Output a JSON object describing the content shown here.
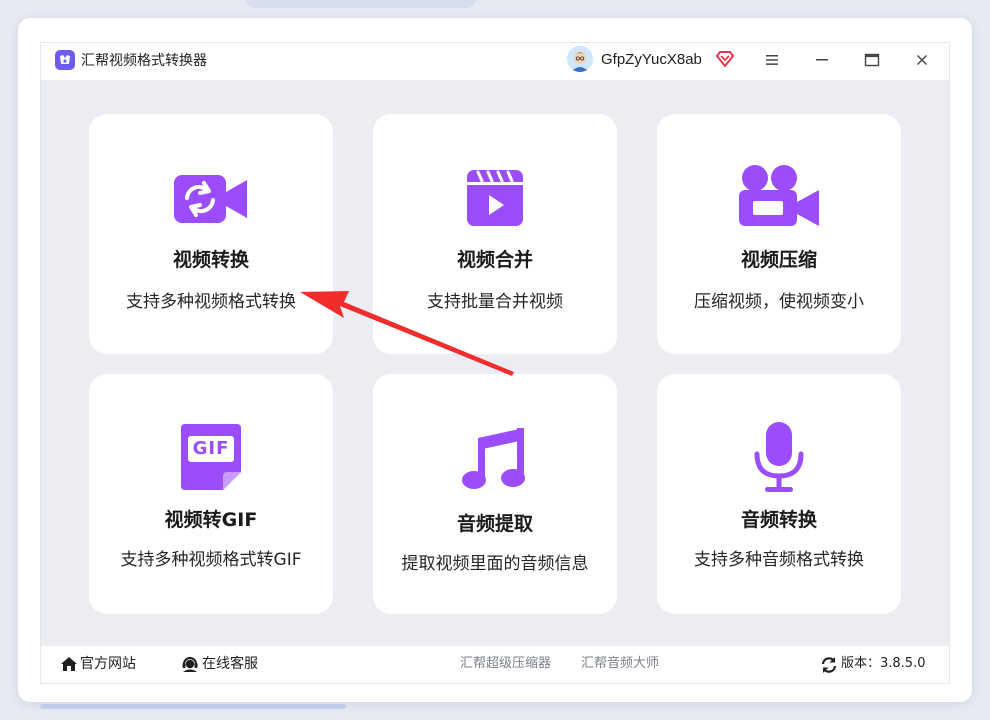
{
  "app": {
    "title": "汇帮视频格式转换器",
    "username": "GfpZyYucX8ab"
  },
  "colors": {
    "accent": "#9b4dfb",
    "arrow": "#f02c2c",
    "vip": "#e8344a",
    "logo": "#6d5cf2"
  },
  "cards": [
    {
      "title": "视频转换",
      "desc": "支持多种视频格式转换",
      "icon": "video-convert-icon"
    },
    {
      "title": "视频合并",
      "desc": "支持批量合并视频",
      "icon": "clapperboard-play-icon"
    },
    {
      "title": "视频压缩",
      "desc": "压缩视频，使视频变小",
      "icon": "video-camera-icon"
    },
    {
      "title": "视频转GIF",
      "desc": "支持多种视频格式转GIF",
      "icon": "gif-file-icon"
    },
    {
      "title": "音频提取",
      "desc": "提取视频里面的音频信息",
      "icon": "music-note-icon"
    },
    {
      "title": "音频转换",
      "desc": "支持多种音频格式转换",
      "icon": "microphone-icon"
    }
  ],
  "gif_icon_text": "GIF",
  "footer": {
    "website": "官方网站",
    "support": "在线客服",
    "link1": "汇帮超级压缩器",
    "link2": "汇帮音频大师",
    "version": "版本：3.8.5.0"
  }
}
